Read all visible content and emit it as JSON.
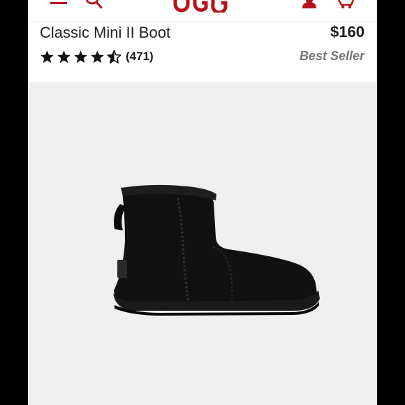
{
  "header": {
    "logo_text": "UGG",
    "icons": [
      "menu-icon",
      "search-icon",
      "account-icon",
      "cart-icon"
    ],
    "brand_color": "#b5121b"
  },
  "product": {
    "title": "Classic Mini II Boot",
    "price": "$160",
    "rating": 4.5,
    "review_count": "(471)",
    "badge": "Best Seller",
    "image": "black-suede-boot"
  },
  "colors": {
    "frame": "#000000",
    "page_background": "#ffffff",
    "image_background": "#efefef",
    "badge_text": "#777777"
  }
}
